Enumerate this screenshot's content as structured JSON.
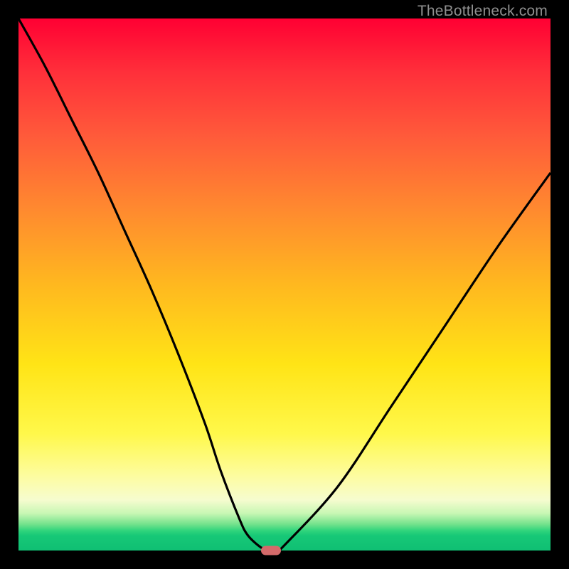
{
  "watermark": "TheBottleneck.com",
  "colors": {
    "background_black": "#000000",
    "curve": "#000000",
    "marker": "#d46a6a",
    "watermark": "#8f8f8f"
  },
  "chart_data": {
    "type": "line",
    "title": "",
    "xlabel": "",
    "ylabel": "",
    "xlim": [
      0,
      100
    ],
    "ylim": [
      0,
      100
    ],
    "grid": false,
    "legend": false,
    "series": [
      {
        "name": "bottleneck-curve",
        "x": [
          0,
          5,
          10,
          15,
          20,
          25,
          30,
          35,
          38,
          41.5,
          43,
          45,
          46.7,
          48.5,
          50,
          60,
          70,
          80,
          90,
          100
        ],
        "y": [
          100,
          91,
          81,
          71,
          60,
          49,
          37,
          24,
          15,
          6,
          3,
          1,
          0,
          0,
          1,
          12,
          27,
          42,
          57,
          71
        ]
      }
    ],
    "marker": {
      "x": 47.5,
      "y": 0
    },
    "gradient_stops": [
      {
        "pos": 0,
        "color": "#ff0033"
      },
      {
        "pos": 0.5,
        "color": "#ffb81f"
      },
      {
        "pos": 0.78,
        "color": "#fff84a"
      },
      {
        "pos": 0.93,
        "color": "#c8f7b4"
      },
      {
        "pos": 1.0,
        "color": "#0fbf73"
      }
    ]
  }
}
